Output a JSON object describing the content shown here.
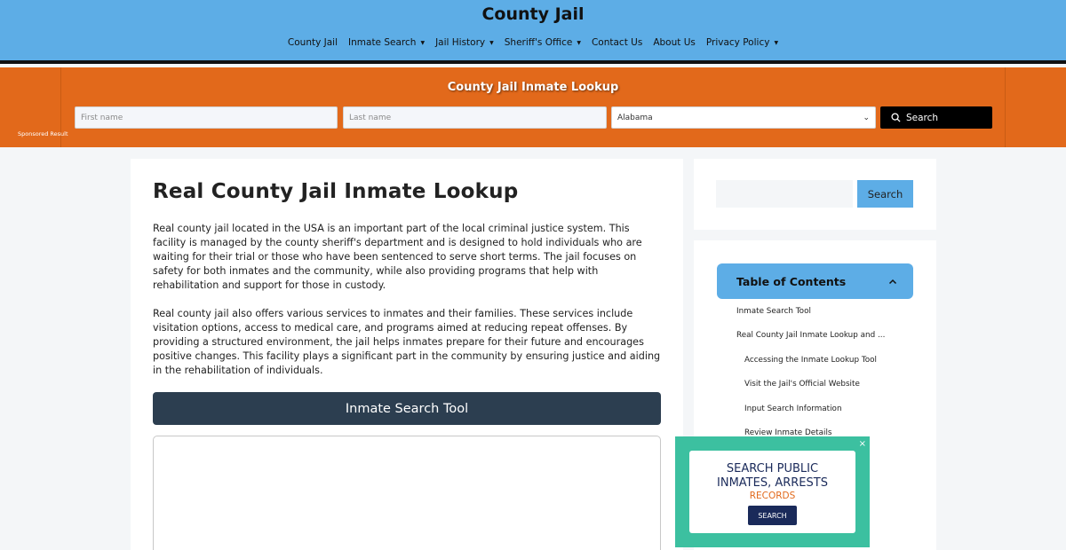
{
  "header": {
    "site_title": "County Jail",
    "nav": [
      {
        "label": "County Jail",
        "dropdown": false
      },
      {
        "label": "Inmate Search",
        "dropdown": true
      },
      {
        "label": "Jail History",
        "dropdown": true
      },
      {
        "label": "Sheriff's Office",
        "dropdown": true
      },
      {
        "label": "Contact Us",
        "dropdown": false
      },
      {
        "label": "About Us",
        "dropdown": false
      },
      {
        "label": "Privacy Policy",
        "dropdown": true
      }
    ]
  },
  "banner": {
    "title": "County Jail Inmate Lookup",
    "first_name_placeholder": "First name",
    "last_name_placeholder": "Last name",
    "state_selected": "Alabama",
    "search_label": "Search",
    "sponsored": "Sponsored Result"
  },
  "article": {
    "title": "Real County Jail Inmate Lookup",
    "paragraph1": "Real county jail located in the USA is an important part of the local criminal justice system. This facility is managed by the county sheriff's department and is designed to hold individuals who are waiting for their trial or those who have been sentenced to serve short terms. The jail focuses on safety for both inmates and the community, while also providing programs that help with rehabilitation and support for those in custody.",
    "paragraph2": "Real county jail also offers various services to inmates and their families. These services include visitation options, access to medical care, and programs aimed at reducing repeat offenses. By providing a structured environment, the jail helps inmates prepare for their future and encourages positive changes. This facility plays a significant part in the community by ensuring justice and aiding in the rehabilitation of individuals.",
    "tool_heading": "Inmate Search Tool"
  },
  "sidebar": {
    "search_label": "Search",
    "toc_title": "Table of Contents",
    "toc_items": [
      {
        "label": "Inmate Search Tool",
        "level": 1
      },
      {
        "label": "Real County Jail Inmate Lookup and ...",
        "level": 1
      },
      {
        "label": "Accessing the Inmate Lookup Tool",
        "level": 2
      },
      {
        "label": "Visit the Jail's Official Website",
        "level": 2
      },
      {
        "label": "Input Search Information",
        "level": 2
      },
      {
        "label": "Review Inmate Details",
        "level": 2
      }
    ]
  },
  "ad": {
    "line1a": "SEARCH PUBLIC",
    "line1b": "INMATES, ARRESTS",
    "line2": "RECORDS",
    "button": "SEARCH",
    "close": "×"
  },
  "colors": {
    "header_bg": "#5dade6",
    "banner_bg": "#e2691b",
    "tool_bar_bg": "#2c3e50",
    "ad_bg": "#3cc0a0",
    "ad_button": "#1a2a5a"
  }
}
